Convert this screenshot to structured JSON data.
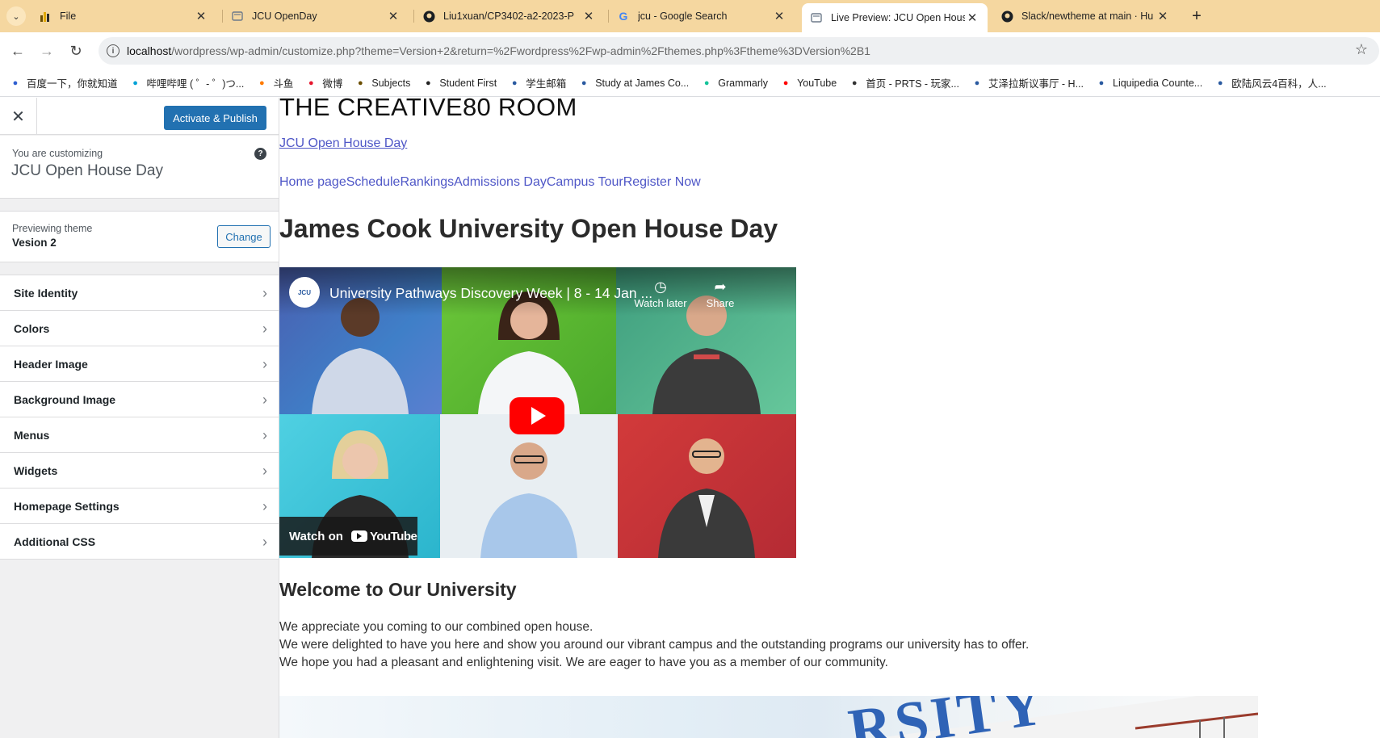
{
  "browser": {
    "tabs": [
      {
        "title": "File",
        "icon": "bar-chart-icon"
      },
      {
        "title": "JCU OpenDay",
        "icon": "page-icon"
      },
      {
        "title": "Liu1xuan/CP3402-a2-2023-P",
        "icon": "github-icon"
      },
      {
        "title": "jcu - Google Search",
        "icon": "google-icon"
      },
      {
        "title": "Live Preview: JCU Open Hous",
        "icon": "page-icon"
      },
      {
        "title": "Slack/newtheme at main · Hu",
        "icon": "github-icon"
      }
    ],
    "url_host": "localhost",
    "url_path": "/wordpress/wp-admin/customize.php?theme=Version+2&return=%2Fwordpress%2Fwp-admin%2Fthemes.php%3Ftheme%3DVersion%2B1",
    "bookmarks": [
      {
        "label": "百度一下，你就知道",
        "icon": "paw-icon",
        "color": "#2f5fd0"
      },
      {
        "label": "哔哩哔哩 ( ゜- ゜)つ...",
        "icon": "tv-icon",
        "color": "#00a1d6"
      },
      {
        "label": "斗鱼",
        "icon": "fish-icon",
        "color": "#ff7a00"
      },
      {
        "label": "微博",
        "icon": "weibo-icon",
        "color": "#e6162d"
      },
      {
        "label": "Subjects",
        "icon": "bar-chart-icon",
        "color": "#6b4e00"
      },
      {
        "label": "Student First",
        "icon": "globe-icon",
        "color": "#222222"
      },
      {
        "label": "学生邮箱",
        "icon": "jcu-icon",
        "color": "#2a5aa0"
      },
      {
        "label": "Study at James Co...",
        "icon": "jcu-icon",
        "color": "#2a5aa0"
      },
      {
        "label": "Grammarly",
        "icon": "grammarly-icon",
        "color": "#15c39a"
      },
      {
        "label": "YouTube",
        "icon": "youtube-icon",
        "color": "#ff0000"
      },
      {
        "label": "首页 - PRTS - 玩家...",
        "icon": "prts-icon",
        "color": "#333333"
      },
      {
        "label": "艾泽拉斯议事厅 - H...",
        "icon": "hearthstone-icon",
        "color": "#2a5aa0"
      },
      {
        "label": "Liquipedia Counte...",
        "icon": "liquipedia-icon",
        "color": "#2a5aa0"
      },
      {
        "label": "欧陆风云4百科，人...",
        "icon": "eu4-icon",
        "color": "#2a5aa0"
      }
    ]
  },
  "customizer": {
    "publish_label": "Activate & Publish",
    "customizing_label": "You are customizing",
    "site_name": "JCU Open House Day",
    "previewing_label": "Previewing theme",
    "theme_name": "Vesion 2",
    "change_label": "Change",
    "sections": [
      {
        "label": "Site Identity"
      },
      {
        "label": "Colors"
      },
      {
        "label": "Header Image"
      },
      {
        "label": "Background Image"
      },
      {
        "label": "Menus"
      },
      {
        "label": "Widgets"
      },
      {
        "label": "Homepage Settings"
      },
      {
        "label": "Additional CSS"
      }
    ]
  },
  "preview": {
    "site_title": "THE CREATIVE80 ROOM",
    "site_link": "JCU Open House Day",
    "nav": [
      "Home page",
      "Schedule",
      "Rankings",
      "Admissions Day",
      "Campus Tour",
      "Register Now"
    ],
    "heading": "James Cook University Open House Day",
    "video": {
      "title": "University Pathways Discovery Week | 8 - 14 Jan ...",
      "watch_later": "Watch later",
      "share": "Share",
      "watch_on": "Watch on",
      "youtube": "YouTube"
    },
    "welcome_heading": "Welcome to Our University",
    "welcome_lines": [
      "We appreciate you coming to our combined open house.",
      "We were delighted to have you here and show you around our vibrant campus and the outstanding programs our university has to offer.",
      "We hope you had a pleasant and enlightening visit. We are eager to have you as a member of our community."
    ],
    "campus_sign_text": "RSITY"
  },
  "colors": {
    "tabstrip": "#f5d7a0",
    "wp_blue": "#2271b1",
    "link": "#4f57c7",
    "youtube_red": "#ff0000"
  }
}
